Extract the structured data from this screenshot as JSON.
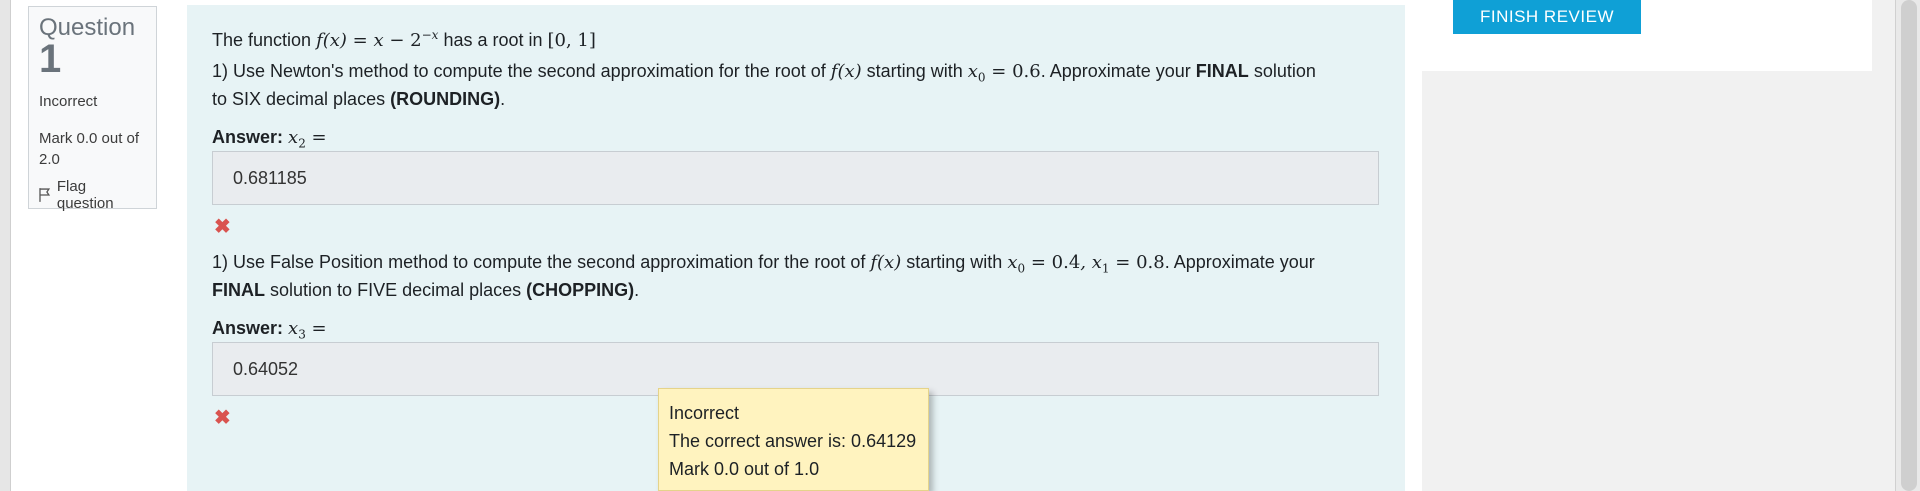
{
  "question_info": {
    "label": "Question",
    "number": "1",
    "state": "Incorrect",
    "grade": "Mark 0.0 out of 2.0",
    "flag_label": "Flag question"
  },
  "question": {
    "intro_prefix": "The function",
    "intro_suffix": "has a root in",
    "part1": {
      "line1_a": "1) Use Newton's method to compute the second approximation for the root of",
      "line1_b": "starting with",
      "line1_c": ". Approximate your",
      "final_word": "FINAL",
      "line1_d": "solution",
      "line2_a": "to SIX decimal places",
      "line2_bold": "(ROUNDING)",
      "line2_end": ".",
      "answer_label": "Answer:",
      "answer_value": "0.681185"
    },
    "part2": {
      "line1_a": "1) Use False Position method to compute the second approximation for the root of",
      "line1_b": "starting with",
      "line1_c": ". Approximate your",
      "final_word": "FINAL",
      "line2_a": "solution to FIVE decimal places",
      "line2_bold": "(CHOPPING)",
      "line2_end": ".",
      "answer_label": "Answer:",
      "answer_value": "0.64052"
    }
  },
  "tooltip": {
    "line1": "Incorrect",
    "line2": "The correct answer is: 0.64129",
    "line3": "Mark 0.0 out of 1.0"
  },
  "nav": {
    "finish_label": "FINISH REVIEW"
  },
  "colors": {
    "accent": "#0fa0d6",
    "incorrect": "#d9534f",
    "tooltip_bg": "#fff3bf",
    "question_bg": "#e7f3f5"
  }
}
